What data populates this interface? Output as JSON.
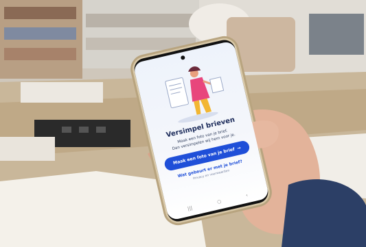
{
  "photo": {
    "description_colors": {
      "wall": "#d9d2c6",
      "table": "#c9b79a",
      "paper": "#f4f1ea",
      "skin": "#e3b39a"
    }
  },
  "app": {
    "status_time": "",
    "title": "Versimpel brieven",
    "subtitle_line1": "Maak een foto van je brief.",
    "subtitle_line2": "Dan versimpelen wij hem voor je.",
    "primary_button": "Maak een foto van je brief",
    "primary_button_icon": "arrow-right-icon",
    "secondary_link": "Wat gebeurt er met je brief?",
    "privacy_link": "Privacy en voorwaarden",
    "accent_color": "#1f4fd8"
  }
}
